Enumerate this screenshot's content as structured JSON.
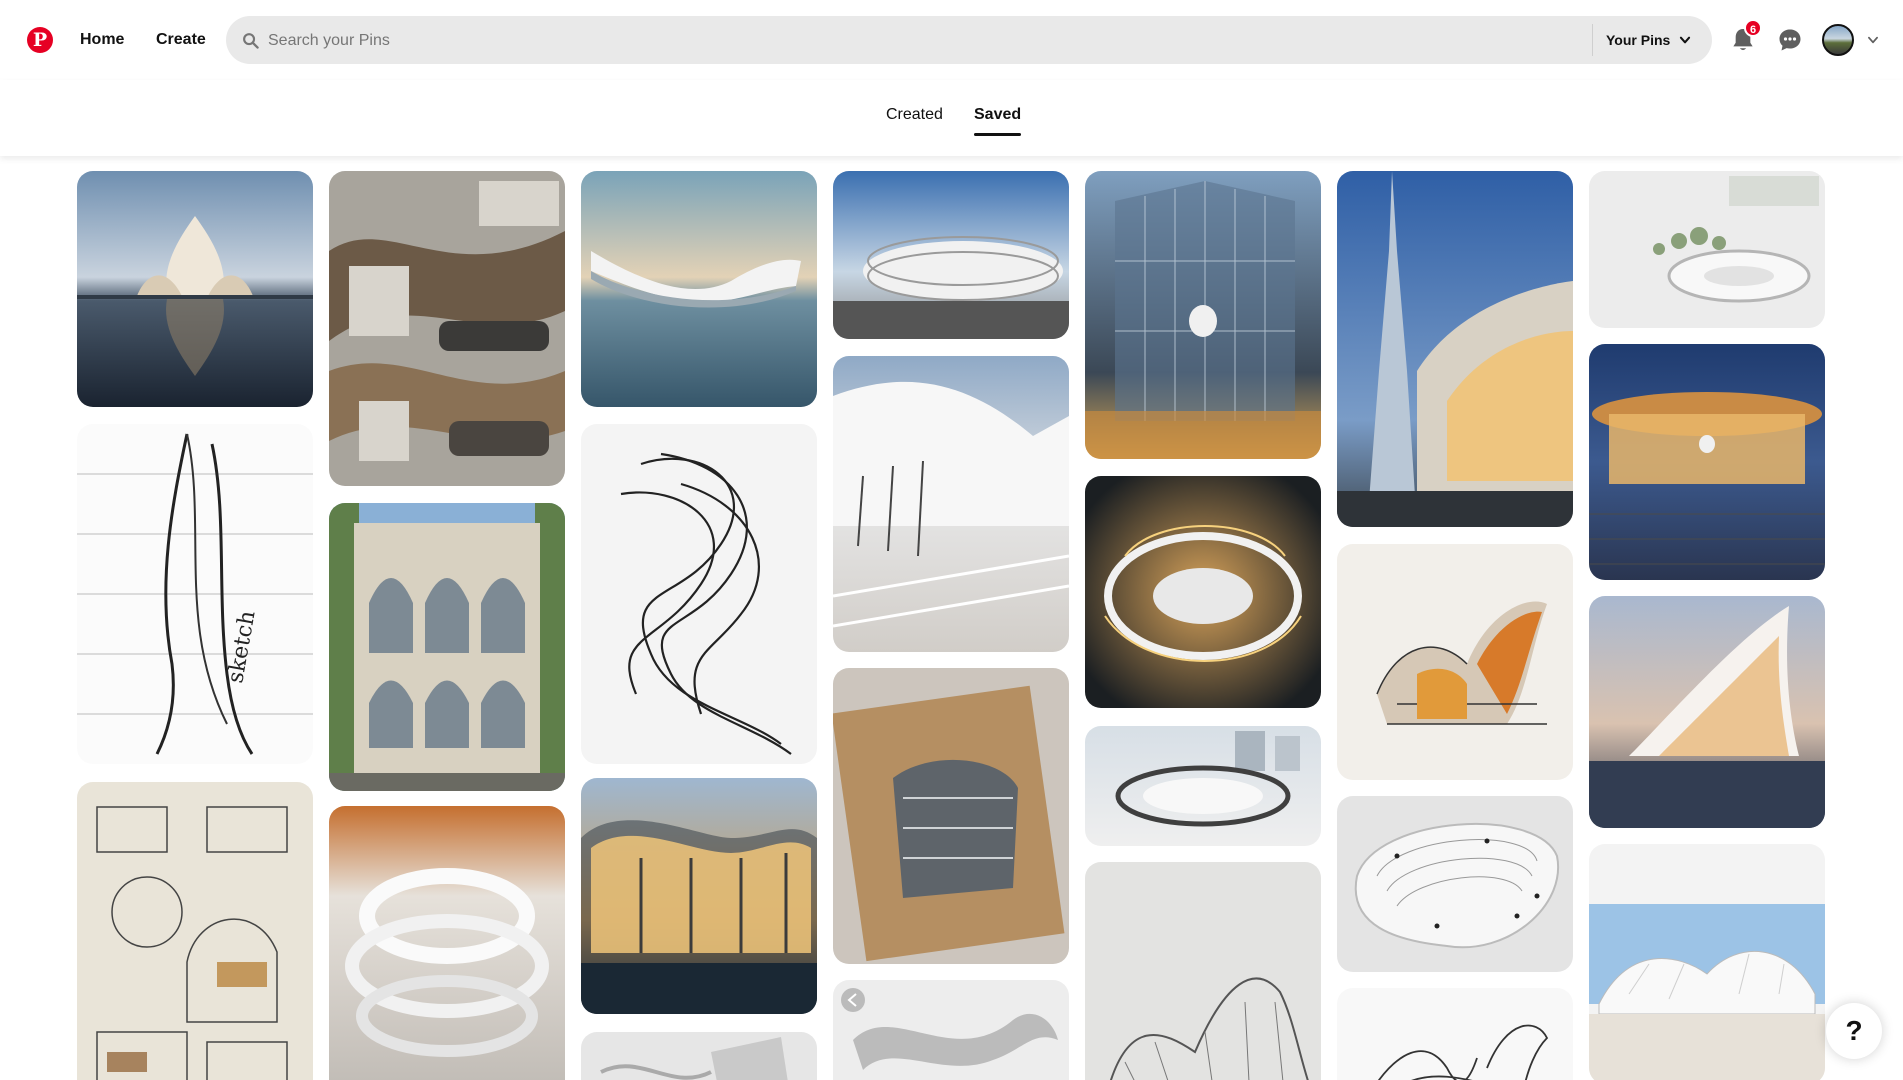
{
  "nav": {
    "home_label": "Home",
    "create_label": "Create"
  },
  "search": {
    "placeholder": "Search your Pins",
    "scope_label": "Your Pins"
  },
  "notifications": {
    "count": "6"
  },
  "tabs": [
    {
      "label": "Created",
      "active": false
    },
    {
      "label": "Saved",
      "active": true
    }
  ],
  "help_label": "?",
  "colors": {
    "brand": "#e60023",
    "search_bg": "#e9e9e9",
    "text": "#111111"
  },
  "pins": [
    {
      "id": "pin-lotus-building-on-water"
    },
    {
      "id": "pin-architecture-presentation-board"
    },
    {
      "id": "pin-curved-building-over-lake"
    },
    {
      "id": "pin-oval-white-building"
    },
    {
      "id": "pin-apple-glass-cube"
    },
    {
      "id": "pin-burj-khalifa-mall"
    },
    {
      "id": "pin-circular-plaza-model"
    },
    {
      "id": "pin-tower-sketch"
    },
    {
      "id": "pin-arched-facade-building"
    },
    {
      "id": "pin-twisting-form-sketch"
    },
    {
      "id": "pin-curved-roof-interior"
    },
    {
      "id": "pin-organic-night-aerial"
    },
    {
      "id": "pin-apple-store-night"
    },
    {
      "id": "pin-house-elevation-sketch"
    },
    {
      "id": "pin-spiral-paper-model"
    },
    {
      "id": "pin-glass-pavilion-night"
    },
    {
      "id": "pin-cardboard-building-sketch"
    },
    {
      "id": "pin-ring-plaza-render"
    },
    {
      "id": "pin-colored-pencil-building"
    },
    {
      "id": "pin-shell-building-dusk"
    },
    {
      "id": "pin-stepped-landscape-model"
    },
    {
      "id": "pin-wireframe-pencil-drawing"
    },
    {
      "id": "pin-wavy-facade-building"
    },
    {
      "id": "pin-ribbon-model"
    },
    {
      "id": "pin-white-shell-roof"
    },
    {
      "id": "pin-pencil-sketch-bottom"
    }
  ]
}
